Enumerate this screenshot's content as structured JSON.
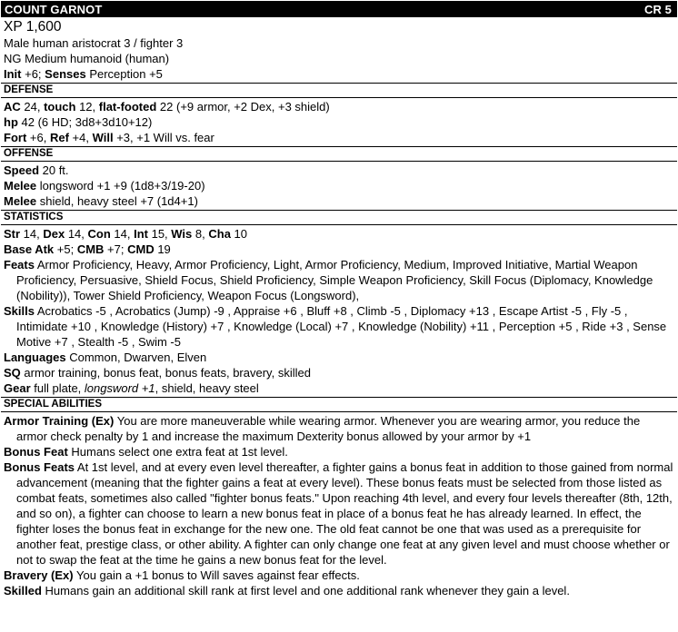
{
  "header": {
    "name": "COUNT GARNOT",
    "cr": "CR 5"
  },
  "xp": "XP 1,600",
  "summary": {
    "line1": "Male human aristocrat 3 / fighter 3",
    "line2": "NG Medium humanoid (human)",
    "init_label": "Init",
    "init_value": " +6; ",
    "senses_label": "Senses",
    "senses_value": "  Perception +5"
  },
  "defense": {
    "title": "DEFENSE",
    "ac_label": "AC",
    "ac_value": " 24, ",
    "touch_label": "touch",
    "touch_value": " 12, ",
    "ff_label": "flat-footed",
    "ff_value": " 22 (+9 armor, +2 Dex, +3 shield)",
    "hp_label": "hp",
    "hp_value": " 42 (6 HD; 3d8+3d10+12)",
    "fort_label": "Fort",
    "fort_value": " +6, ",
    "ref_label": "Ref",
    "ref_value": " +4, ",
    "will_label": "Will",
    "will_value": " +3, +1 Will vs. fear"
  },
  "offense": {
    "title": "OFFENSE",
    "speed_label": "Speed",
    "speed_value": " 20 ft.",
    "melee1_label": "Melee",
    "melee1_value": " longsword +1 +9  (1d8+3/19-20)",
    "melee2_label": "Melee",
    "melee2_value": " shield, heavy steel +7  (1d4+1)"
  },
  "statistics": {
    "title": "STATISTICS",
    "str_label": "Str",
    "str_value": " 14, ",
    "dex_label": "Dex",
    "dex_value": " 14, ",
    "con_label": "Con",
    "con_value": " 14, ",
    "int_label": "Int",
    "int_value": " 15, ",
    "wis_label": "Wis",
    "wis_value": " 8, ",
    "cha_label": "Cha",
    "cha_value": " 10",
    "bab_label": "Base Atk",
    "bab_value": " +5; ",
    "cmb_label": "CMB",
    "cmb_value": " +7; ",
    "cmd_label": "CMD",
    "cmd_value": " 19",
    "feats_label": "Feats",
    "feats_value": " Armor Proficiency, Heavy, Armor Proficiency, Light, Armor Proficiency, Medium, Improved Initiative, Martial Weapon Proficiency, Persuasive, Shield Focus, Shield Proficiency, Simple Weapon Proficiency, Skill Focus (Diplomacy, Knowledge (Nobility)), Tower Shield Proficiency, Weapon Focus (Longsword),",
    "skills_label": "Skills",
    "skills_value": " Acrobatics -5 , Acrobatics (Jump) -9 , Appraise +6 , Bluff +8 , Climb -5 , Diplomacy +13 , Escape Artist -5 , Fly -5 , Intimidate +10 , Knowledge (History) +7 , Knowledge (Local) +7 , Knowledge (Nobility) +11 , Perception +5 , Ride +3 , Sense Motive +7 , Stealth -5 , Swim -5",
    "languages_label": "Languages",
    "languages_value": " Common, Dwarven, Elven",
    "sq_label": "SQ",
    "sq_value": " armor training, bonus feat, bonus feats, bravery, skilled",
    "gear_label": "Gear",
    "gear_value_a": "  full plate, ",
    "gear_value_italic": "longsword +1",
    "gear_value_b": ", shield, heavy steel"
  },
  "special": {
    "title": "SPECIAL ABILITIES",
    "armor_training_label": "Armor Training (Ex)",
    "armor_training_text": "  You are more maneuverable while wearing armor. Whenever you are wearing armor, you reduce the armor check penalty by 1 and increase the maximum Dexterity bonus allowed by your armor by +1",
    "bonus_feat_label": "Bonus Feat",
    "bonus_feat_text": "  Humans select one extra feat at 1st level.",
    "bonus_feats_label": "Bonus Feats",
    "bonus_feats_text": "  At 1st level, and at every even level thereafter, a fighter gains a bonus feat in addition to those gained from normal advancement (meaning that the fighter gains a feat at every level). These bonus feats must be selected from those listed as combat feats, sometimes also called \"fighter bonus feats.\" Upon reaching 4th level, and every four levels thereafter (8th, 12th, and so on), a fighter can choose to learn a new bonus feat in place of a bonus feat he has already learned. In effect, the fighter loses the bonus feat in exchange for the new one. The old feat cannot be one that was used as a prerequisite for another feat, prestige class, or other ability. A fighter can only change one feat at any given level and must choose whether or not to swap the feat at the time he gains a new bonus feat for the level.",
    "bravery_label": "Bravery (Ex)",
    "bravery_text": "  You gain a +1 bonus to Will saves against fear effects.",
    "skilled_label": "Skilled",
    "skilled_text": "  Humans gain an additional skill rank at first level and one additional rank whenever they gain a level."
  }
}
